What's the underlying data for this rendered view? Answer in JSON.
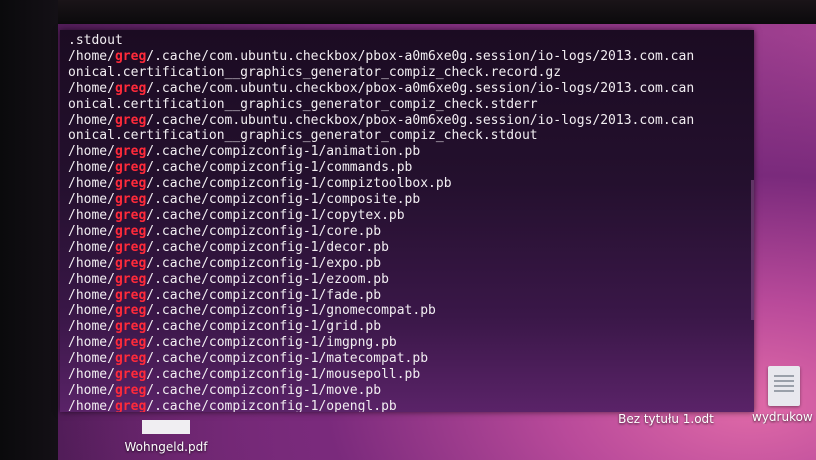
{
  "terminal": {
    "lines": [
      {
        "pre": ".stdout",
        "user": "",
        "post": ""
      },
      {
        "pre": "/home/",
        "user": "greg",
        "post": "/.cache/com.ubuntu.checkbox/pbox-a0m6xe0g.session/io-logs/2013.com.can"
      },
      {
        "pre": "onical.certification__graphics_generator_compiz_check.record.gz",
        "user": "",
        "post": ""
      },
      {
        "pre": "/home/",
        "user": "greg",
        "post": "/.cache/com.ubuntu.checkbox/pbox-a0m6xe0g.session/io-logs/2013.com.can"
      },
      {
        "pre": "onical.certification__graphics_generator_compiz_check.stderr",
        "user": "",
        "post": ""
      },
      {
        "pre": "/home/",
        "user": "greg",
        "post": "/.cache/com.ubuntu.checkbox/pbox-a0m6xe0g.session/io-logs/2013.com.can"
      },
      {
        "pre": "onical.certification__graphics_generator_compiz_check.stdout",
        "user": "",
        "post": ""
      },
      {
        "pre": "/home/",
        "user": "greg",
        "post": "/.cache/compizconfig-1/animation.pb"
      },
      {
        "pre": "/home/",
        "user": "greg",
        "post": "/.cache/compizconfig-1/commands.pb"
      },
      {
        "pre": "/home/",
        "user": "greg",
        "post": "/.cache/compizconfig-1/compiztoolbox.pb"
      },
      {
        "pre": "/home/",
        "user": "greg",
        "post": "/.cache/compizconfig-1/composite.pb"
      },
      {
        "pre": "/home/",
        "user": "greg",
        "post": "/.cache/compizconfig-1/copytex.pb"
      },
      {
        "pre": "/home/",
        "user": "greg",
        "post": "/.cache/compizconfig-1/core.pb"
      },
      {
        "pre": "/home/",
        "user": "greg",
        "post": "/.cache/compizconfig-1/decor.pb"
      },
      {
        "pre": "/home/",
        "user": "greg",
        "post": "/.cache/compizconfig-1/expo.pb"
      },
      {
        "pre": "/home/",
        "user": "greg",
        "post": "/.cache/compizconfig-1/ezoom.pb"
      },
      {
        "pre": "/home/",
        "user": "greg",
        "post": "/.cache/compizconfig-1/fade.pb"
      },
      {
        "pre": "/home/",
        "user": "greg",
        "post": "/.cache/compizconfig-1/gnomecompat.pb"
      },
      {
        "pre": "/home/",
        "user": "greg",
        "post": "/.cache/compizconfig-1/grid.pb"
      },
      {
        "pre": "/home/",
        "user": "greg",
        "post": "/.cache/compizconfig-1/imgpng.pb"
      },
      {
        "pre": "/home/",
        "user": "greg",
        "post": "/.cache/compizconfig-1/matecompat.pb"
      },
      {
        "pre": "/home/",
        "user": "greg",
        "post": "/.cache/compizconfig-1/mousepoll.pb"
      },
      {
        "pre": "/home/",
        "user": "greg",
        "post": "/.cache/compizconfig-1/move.pb"
      },
      {
        "pre": "/home/",
        "user": "greg",
        "post": "/.cache/compizconfig-1/opengl.pb"
      }
    ]
  },
  "desktop": {
    "icons": [
      {
        "label": "Wohngeld.pdf",
        "icon": "pdf-file-icon"
      },
      {
        "label": "Bez tytułu 1.odt",
        "icon": "odt-file-icon"
      },
      {
        "label": "wydrukow",
        "icon": "document-icon"
      }
    ]
  },
  "colors": {
    "username": "#ff2a3a",
    "terminal_text": "#f2eef2",
    "desktop_purple": "#7b2c7c"
  }
}
